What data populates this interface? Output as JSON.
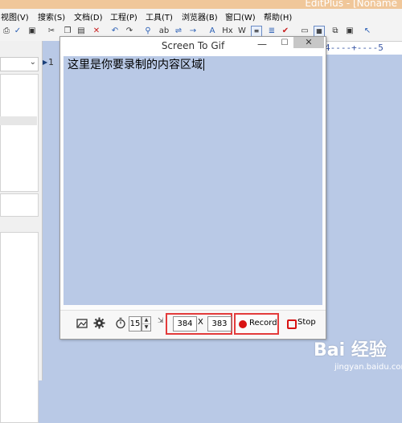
{
  "app": {
    "title_fragment": "EditPlus - [Noname",
    "menu": [
      "视图(V)",
      "搜索(S)",
      "文档(D)",
      "工程(P)",
      "工具(T)",
      "浏览器(B)",
      "窗口(W)",
      "帮助(H)"
    ],
    "ruler_text": "4----+----5",
    "line_number": "1"
  },
  "gif_window": {
    "title": "Screen To Gif",
    "minimize_glyph": "—",
    "maximize_glyph": "☐",
    "close_glyph": "✕",
    "capture_text": "这里是你要录制的内容区域",
    "frame_rate": "15",
    "width": "384",
    "separator": "X",
    "height": "383",
    "record_label": "Record",
    "stop_label": "Stop"
  },
  "watermark": {
    "logo": "Bai 经验",
    "url": "jingyan.baidu.com"
  },
  "colors": {
    "capture_bg": "#b9c9e6",
    "highlight": "#e33b3b",
    "record_dot": "#d81313"
  }
}
